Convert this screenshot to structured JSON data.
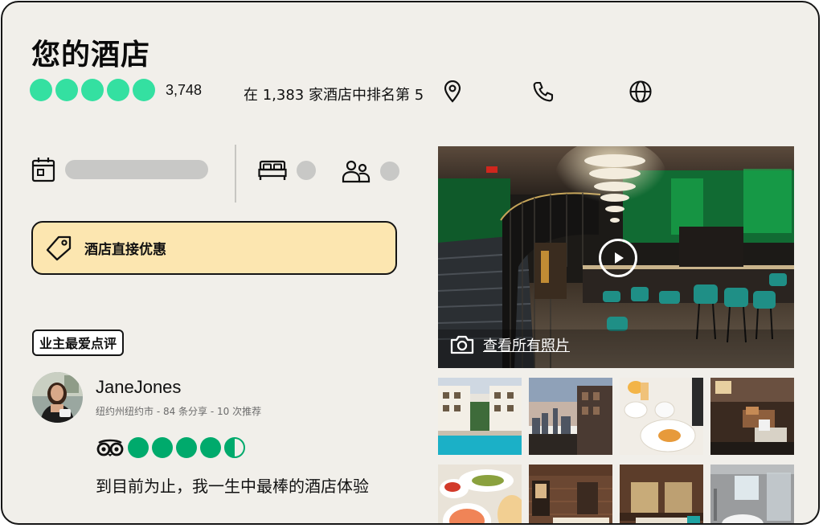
{
  "hotel": {
    "title": "您的酒店",
    "review_count": "3,748",
    "ranking": "在 1,383 家酒店中排名第 5",
    "bubbles": 5
  },
  "icons": {
    "location": "map-pin-icon",
    "phone": "phone-icon",
    "website": "globe-icon",
    "calendar": "calendar-icon",
    "bed": "bed-icon",
    "guests": "guests-icon",
    "tag": "price-tag-icon",
    "camera": "camera-icon",
    "play": "play-icon"
  },
  "deal": {
    "label": "酒店直接优惠"
  },
  "review": {
    "badge": "业主最爱点评",
    "reviewer_name": "JaneJones",
    "reviewer_meta": "纽约州纽约市 - 84 条分享 - 10 次推荐",
    "rating": 4.5,
    "quote": "到目前为止，我一生中最棒的酒店体验"
  },
  "gallery": {
    "see_all_label": "查看所有照片",
    "thumbnail_count": 8
  },
  "colors": {
    "rating_green": "#34e0a1",
    "review_green": "#00aa6c",
    "deal_bg": "#fce6b0",
    "card_bg": "#f1efea"
  }
}
